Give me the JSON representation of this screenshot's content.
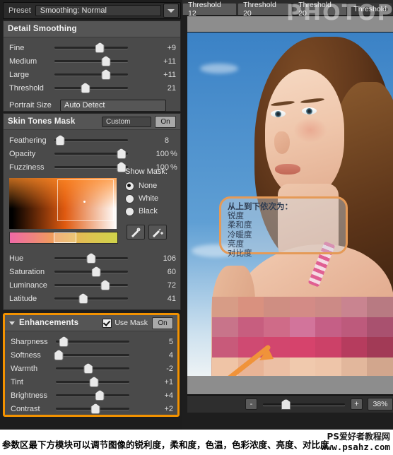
{
  "preset": {
    "label": "Preset",
    "value": "Smoothing: Normal",
    "caret_icon": "chevron-down-icon"
  },
  "detail_smoothing": {
    "title": "Detail Smoothing",
    "sliders": [
      {
        "name": "Fine",
        "value": "+9",
        "pos": 62
      },
      {
        "name": "Medium",
        "value": "+11",
        "pos": 70
      },
      {
        "name": "Large",
        "value": "+11",
        "pos": 70
      },
      {
        "name": "Threshold",
        "value": "21",
        "pos": 42
      }
    ],
    "portrait_size": {
      "label": "Portrait Size",
      "value": "Auto Detect"
    }
  },
  "skin_tones_mask": {
    "title": "Skin Tones Mask",
    "preset_value": "Custom",
    "on_label": "On",
    "sliders": [
      {
        "name": "Feathering",
        "value": "8",
        "unit": "",
        "pos": 8
      },
      {
        "name": "Opacity",
        "value": "100",
        "unit": "%",
        "pos": 91
      },
      {
        "name": "Fuzziness",
        "value": "100",
        "unit": "%",
        "pos": 91
      }
    ],
    "show_mask": {
      "title": "Show Mask:",
      "options": [
        {
          "label": "None",
          "selected": true
        },
        {
          "label": "White",
          "selected": false
        },
        {
          "label": "Black",
          "selected": false
        }
      ]
    },
    "tools": [
      "eyedropper-icon",
      "eyedropper-add-icon"
    ],
    "hsl_sliders": [
      {
        "name": "Hue",
        "value": "106",
        "pos": 50
      },
      {
        "name": "Saturation",
        "value": "60",
        "pos": 57
      },
      {
        "name": "Luminance",
        "value": "72",
        "pos": 69
      },
      {
        "name": "Latitude",
        "value": "41",
        "pos": 39
      }
    ]
  },
  "enhancements": {
    "title": "Enhancements",
    "disclosure_icon": "triangle-down-icon",
    "use_mask_label": "Use Mask",
    "use_mask_checked": true,
    "on_label": "On",
    "highlight_color": "#f39200",
    "sliders": [
      {
        "name": "Sharpness",
        "value": "5",
        "pos": 11
      },
      {
        "name": "Softness",
        "value": "4",
        "pos": 4
      },
      {
        "name": "Warmth",
        "value": "-2",
        "pos": 44
      },
      {
        "name": "Tint",
        "value": "+1",
        "pos": 52
      },
      {
        "name": "Brightness",
        "value": "+4",
        "pos": 60
      },
      {
        "name": "Contrast",
        "value": "+2",
        "pos": 54
      }
    ]
  },
  "tabs": [
    {
      "label": "Threshold 12",
      "active": false
    },
    {
      "label": "Threshold 20",
      "active": false
    },
    {
      "label": "Threshold 20",
      "active": false
    },
    {
      "label": "Threshold",
      "active": true
    }
  ],
  "callout": {
    "lines": [
      "从上到下依次为：",
      "锐度",
      "柔和度",
      "冷暖度",
      "亮度",
      "对比度"
    ]
  },
  "zoom_bar": {
    "minus_label": "-",
    "plus_label": "+",
    "zoom_value": "38%"
  },
  "caption": {
    "text": "参数区最下方模块可以调节图像的锐利度，柔和度，色温，色彩浓度、亮度、对比度",
    "watermark_site": "PS爱好者教程网",
    "watermark_url": "www.psahz.com",
    "watermark_big": "PHOTOPS.COM"
  }
}
